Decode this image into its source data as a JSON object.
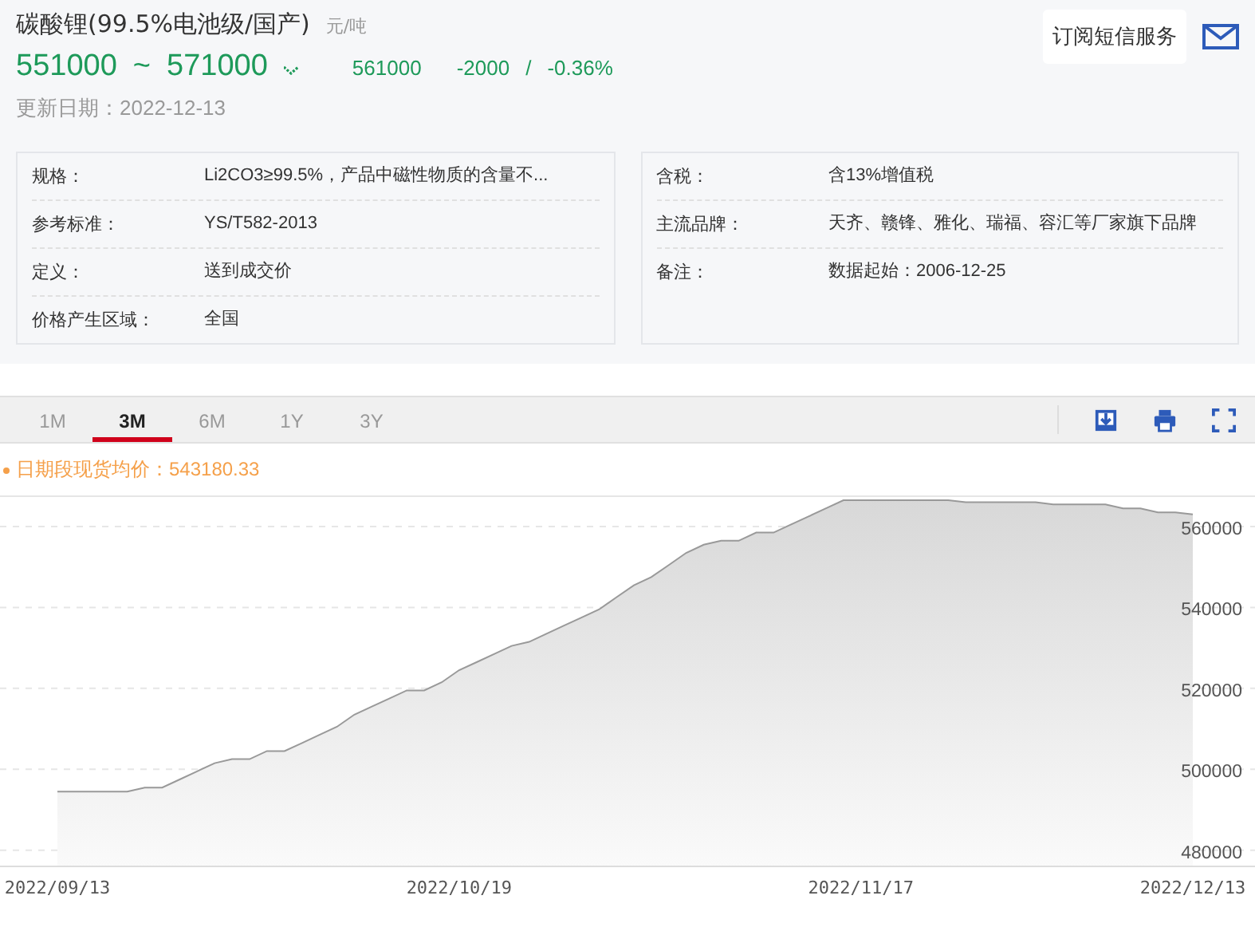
{
  "header": {
    "title": "碳酸锂(99.5%电池级/国产)",
    "unit": "元/吨",
    "price_range_low": "551000",
    "range_separator": "~",
    "price_range_high": "571000",
    "average": "561000",
    "change": "-2000",
    "change_separator": "/",
    "change_percent": "-0.36%",
    "updated": "更新日期：2022-12-13",
    "subscribe_button": "订阅短信服务"
  },
  "info_left": [
    {
      "label": "规格：",
      "value": "Li2CO3≥99.5%，产品中磁性物质的含量不..."
    },
    {
      "label": "参考标准：",
      "value": "YS/T582-2013"
    },
    {
      "label": "定义：",
      "value": "送到成交价"
    },
    {
      "label": "价格产生区域：",
      "value": "全国"
    }
  ],
  "info_right": [
    {
      "label": "含税：",
      "value": "含13%增值税"
    },
    {
      "label": "主流品牌：",
      "value": "天齐、赣锋、雅化、瑞福、容汇等厂家旗下品牌"
    },
    {
      "label": "备注：",
      "value": "数据起始：2006-12-25"
    }
  ],
  "range_tabs": [
    {
      "label": "1M",
      "selected": false
    },
    {
      "label": "3M",
      "selected": true
    },
    {
      "label": "6M",
      "selected": false
    },
    {
      "label": "1Y",
      "selected": false
    },
    {
      "label": "3Y",
      "selected": false
    }
  ],
  "legend_value": "：543180.33",
  "chart_data": {
    "type": "area",
    "categories": [
      "2022/09/13",
      null,
      null,
      null,
      null,
      null,
      null,
      null,
      null,
      null,
      null,
      null,
      null,
      null,
      null,
      null,
      null,
      null,
      null,
      null,
      null,
      null,
      null,
      "2022/10/19",
      null,
      null,
      null,
      null,
      null,
      null,
      null,
      null,
      null,
      null,
      null,
      null,
      null,
      null,
      null,
      null,
      null,
      null,
      null,
      null,
      null,
      null,
      "2022/11/17",
      null,
      null,
      null,
      null,
      null,
      null,
      null,
      null,
      null,
      null,
      null,
      null,
      null,
      null,
      null,
      null,
      null,
      null,
      "2022/12/13"
    ],
    "series": [
      {
        "name": "日期段现货均价",
        "color": "#999999",
        "values": [
          494500,
          494500,
          494500,
          494500,
          494500,
          495500,
          495500,
          497500,
          499500,
          501500,
          502500,
          502500,
          504500,
          504500,
          506500,
          508500,
          510500,
          513500,
          515500,
          517500,
          519500,
          519500,
          521500,
          524500,
          526500,
          528500,
          530500,
          531500,
          533500,
          535500,
          537500,
          539500,
          542500,
          545500,
          547500,
          550500,
          553500,
          555500,
          556500,
          556500,
          558500,
          558500,
          560500,
          562500,
          564500,
          566500,
          566500,
          566500,
          566500,
          566500,
          566500,
          566500,
          566000,
          566000,
          566000,
          566000,
          566000,
          565500,
          565500,
          565500,
          565500,
          564500,
          564500,
          563500,
          563500,
          563000
        ]
      }
    ],
    "yticks": [
      480000,
      500000,
      520000,
      540000,
      560000
    ],
    "ylim": [
      476000,
      567500
    ],
    "grid": true
  }
}
